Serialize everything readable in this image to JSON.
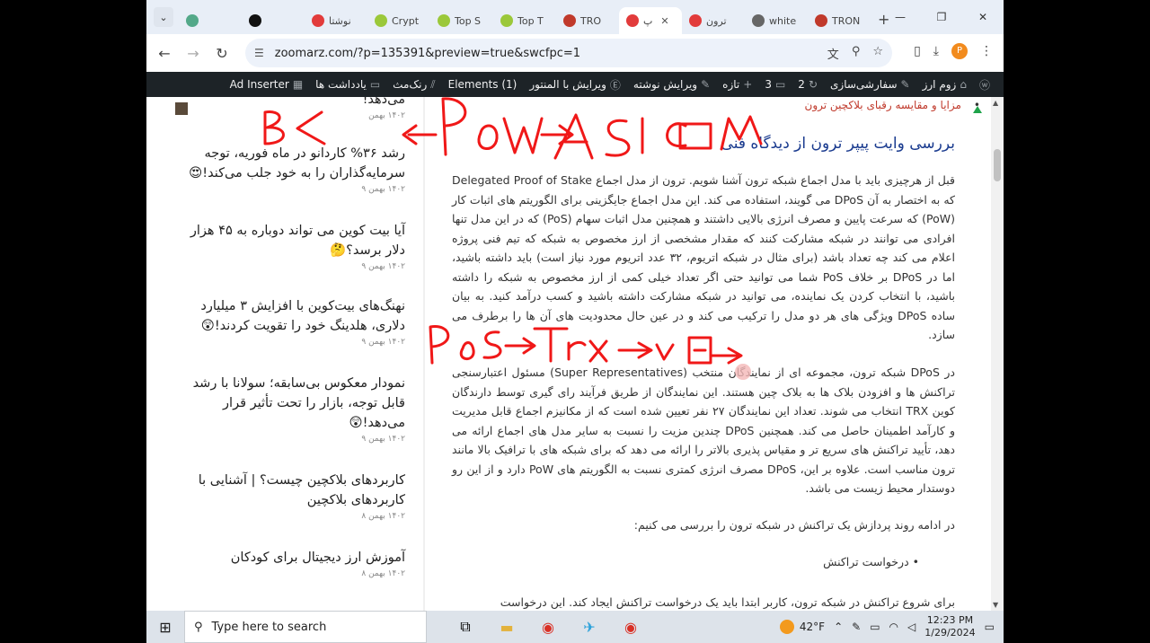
{
  "browser": {
    "tabs": [
      {
        "label": "",
        "favicon": "#53a889",
        "active": false
      },
      {
        "label": "",
        "favicon": "#111111",
        "active": false
      },
      {
        "label": "نوشتا",
        "favicon": "#e23b3b",
        "active": false
      },
      {
        "label": "Crypt",
        "favicon": "#9bc83a",
        "active": false
      },
      {
        "label": "Top S",
        "favicon": "#9bc83a",
        "active": false
      },
      {
        "label": "Top T",
        "favicon": "#9bc83a",
        "active": false
      },
      {
        "label": "TRO",
        "favicon": "#c0392b",
        "active": false
      },
      {
        "label": "پ",
        "favicon": "#e23b3b",
        "active": true
      },
      {
        "label": "ترون",
        "favicon": "#e23b3b",
        "active": false
      },
      {
        "label": "white",
        "favicon": "#666666",
        "active": false
      },
      {
        "label": "TRON",
        "favicon": "#c0392b",
        "active": false
      }
    ],
    "url": "zoomarz.com/?p=135391&preview=true&swcfpc=1",
    "profile_initial": "P"
  },
  "adminbar": {
    "site": "زوم ارز",
    "customize": "سفارشی‌سازی",
    "updates": "2",
    "comments": "3",
    "new": "تازه",
    "edit_post": "ویرایش نوشته",
    "edit_elementor": "ویرایش با المنتور",
    "elements": "Elements (1)",
    "seo": "رنک‌مث",
    "notes": "یادداشت ها",
    "ad_inserter": "Ad Inserter"
  },
  "sidebar": {
    "items": [
      {
        "title": "می‌دهد!",
        "date": "۱۴۰۲ بهمن"
      },
      {
        "title": "رشد ۳۶% کاردانو در ماه فوریه، توجه سرمایه‌گذاران را به خود جلب می‌کند!😍",
        "date": "۱۴۰۲ بهمن ۹"
      },
      {
        "title": "آیا بیت کوین می تواند دوباره به ۴۵ هزار دلار برسد؟🤔",
        "date": "۱۴۰۲ بهمن ۹"
      },
      {
        "title": "نهنگ‌های بیت‌کوین با افزایش ۳ میلیارد دلاری، هلدینگ خود را تقویت کردند!😲",
        "date": "۱۴۰۲ بهمن ۹"
      },
      {
        "title": "نمودار معکوس بی‌سابقه؛ سولانا با رشد قابل توجه، بازار را تحت تأثیر قرار می‌دهد!😲",
        "date": "۱۴۰۲ بهمن ۹"
      },
      {
        "title": "کاربردهای بلاکچین چیست؟ | آشنایی با کاربردهای بلاکچین",
        "date": "۱۴۰۲ بهمن ۸"
      },
      {
        "title": "آموزش ارز دیجیتال برای کودکان",
        "date": "۱۴۰۲ بهمن ۸"
      }
    ]
  },
  "article": {
    "top_bullet": "مزایا و مقایسه رقبای بلاکچین ترون",
    "heading": "بررسی وایت پیپر ترون از دیدگاه فنی",
    "para1": "قبل از هرچیزی باید با مدل اجماع شبکه ترون آشنا شویم. ترون از مدل اجماع Delegated Proof of Stake که به اختصار به آن DPoS می گویند، استفاده می کند. این مدل اجماع جایگزینی برای الگوریتم های اثبات کار (PoW) که سرعت پایین و مصرف انرژی بالایی داشتند و همچنین مدل اثبات سهام (PoS) که در این مدل تنها افرادی می توانند در شبکه مشارکت کنند که مقدار مشخصی از ارز مخصوص به شبکه که تیم فنی پروژه اعلام می کند چه تعداد باشد (برای مثال در شبکه اتریوم، ۳۲ عدد اتریوم مورد نیاز است) باید داشته باشید، اما در DPoS بر خلاف PoS شما می توانید حتی اگر تعداد خیلی کمی از ارز مخصوص به شبکه را داشته باشید، با انتخاب کردن یک نماینده، می توانید در شبکه مشارکت داشته باشید و کسب درآمد کنید. به بیان ساده DPoS ویژگی های هر دو مدل را ترکیب می کند و در عین حال محدودیت های آن ها را برطرف می سازد.",
    "para2": "در DPoS شبکه ترون، مجموعه ای از نمایندگان منتخب (Super Representatives) مسئول اعتبارسنجی تراکنش ها و افزودن بلاک ها به بلاک چین هستند. این نمایندگان از طریق فرآیند رای گیری توسط دارندگان کوین TRX انتخاب می شوند. تعداد این نمایندگان ۲۷ نفر تعیین شده است که از مکانیزم اجماع قابل مدیریت و کارآمد اطمینان حاصل می کند. همچنین DPoS چندین مزیت را نسبت به سایر مدل های اجماع ارائه می دهد، تأیید تراکنش های سریع تر و مقیاس پذیری بالاتر را ارائه می دهد که برای شبکه های با ترافیک بالا مانند ترون مناسب است. علاوه بر این، DPoS مصرف انرژی کمتری نسبت به الگوریتم های PoW دارد و از این رو دوستدار محیط زیست می باشد.",
    "para3": "در ادامه روند پردازش یک تراکنش در شبکه ترون را بررسی می کنیم:",
    "list1": "درخواست تراکنش",
    "para4": "برای شروع تراکنش در شبکه ترون، کاربر ابتدا باید یک درخواست تراکنش ایجاد کند. این درخواست"
  },
  "annotations": {
    "line1": "B< ← PoW → ASIC M",
    "line2": "PoS → Trx → v E →"
  },
  "taskbar": {
    "search_placeholder": "Type here to search",
    "weather": "42°F",
    "time": "12:23 PM",
    "date": "1/29/2024"
  }
}
